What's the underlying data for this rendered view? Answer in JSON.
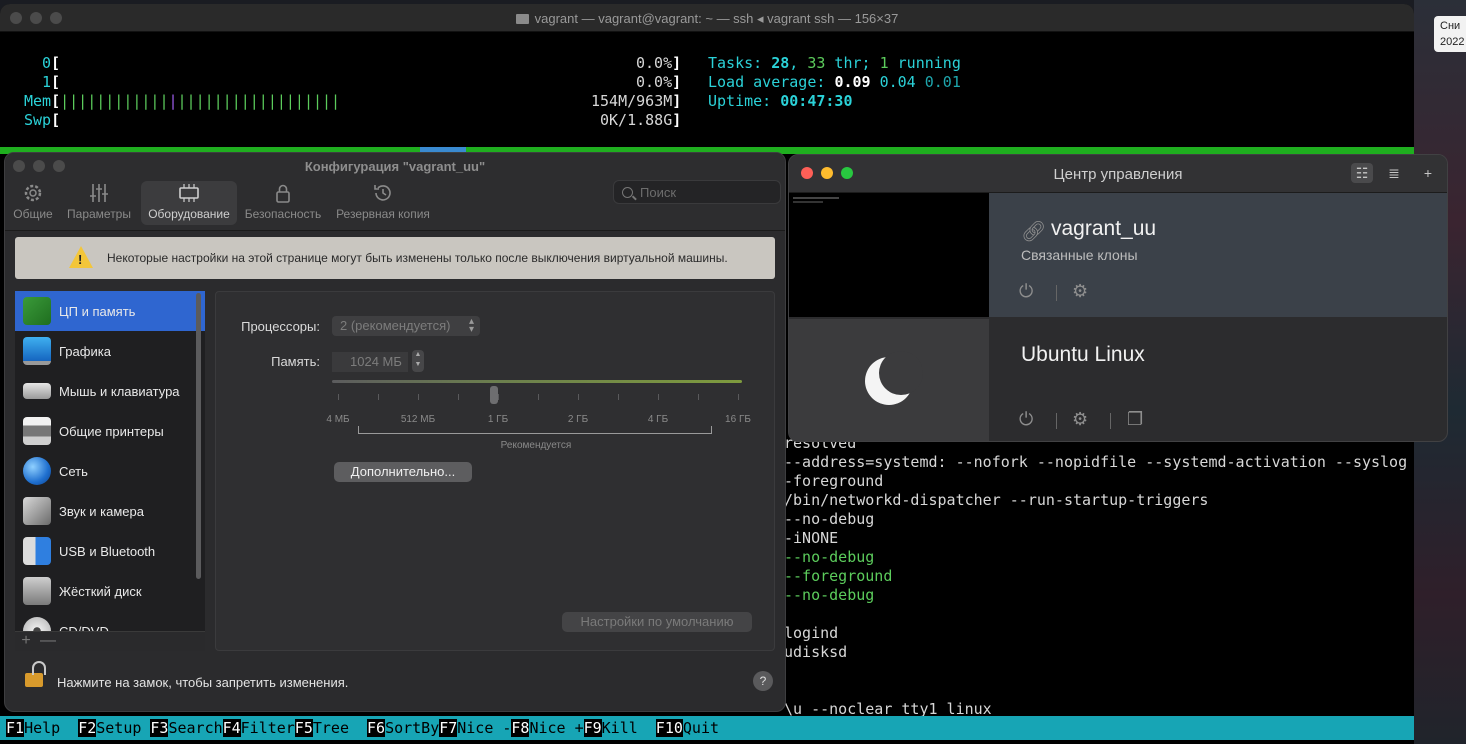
{
  "desktop": {
    "badge_line1": "Сни",
    "badge_line2": "2022"
  },
  "terminal": {
    "title": "vagrant — vagrant@vagrant: ~ — ssh ◂ vagrant ssh — 156×37",
    "cpu0": {
      "label": "0",
      "value": "0.0%"
    },
    "cpu1": {
      "label": "1",
      "value": "0.0%"
    },
    "mem": {
      "label": "Mem",
      "value": "154M/963M"
    },
    "swp": {
      "label": "Swp",
      "value": "0K/1.88G"
    },
    "tasks_label": "Tasks: ",
    "tasks_count": "28",
    "thr_count": "33",
    "thr_label": " thr; ",
    "running_count": "1",
    "running_label": " running",
    "load_label": "Load average: ",
    "load1": "0.09",
    "load5": "0.04",
    "load15": "0.01",
    "uptime_label": "Uptime: ",
    "uptime": "00:47:30",
    "lines": [
      {
        "text": "resolved",
        "color": "white"
      },
      {
        "text": "--address=systemd: --nofork --nopidfile --systemd-activation --syslog",
        "color": "white"
      },
      {
        "text": "-foreground",
        "color": "white"
      },
      {
        "text": "/bin/networkd-dispatcher --run-startup-triggers",
        "color": "white"
      },
      {
        "text": "--no-debug",
        "color": "white"
      },
      {
        "text": "-iNONE",
        "color": "white"
      },
      {
        "text": "--no-debug",
        "color": "green"
      },
      {
        "text": "--foreground",
        "color": "green"
      },
      {
        "text": "--no-debug",
        "color": "green"
      },
      {
        "text": "",
        "color": "white"
      },
      {
        "text": "logind",
        "color": "white"
      },
      {
        "text": "udisksd",
        "color": "white"
      },
      {
        "text": "",
        "color": "white"
      },
      {
        "text": "",
        "color": "white"
      },
      {
        "text": "\\u --noclear tty1 linux",
        "color": "white"
      }
    ],
    "fkeys": [
      {
        "key": "F1",
        "label": "Help  "
      },
      {
        "key": "F2",
        "label": "Setup "
      },
      {
        "key": "F3",
        "label": "Search"
      },
      {
        "key": "F4",
        "label": "Filter"
      },
      {
        "key": "F5",
        "label": "Tree  "
      },
      {
        "key": "F6",
        "label": "SortBy"
      },
      {
        "key": "F7",
        "label": "Nice -"
      },
      {
        "key": "F8",
        "label": "Nice +"
      },
      {
        "key": "F9",
        "label": "Kill  "
      },
      {
        "key": "F10",
        "label": "Quit"
      }
    ]
  },
  "config": {
    "title": "Конфигурация \"vagrant_uu\"",
    "tabs": [
      "Общие",
      "Параметры",
      "Оборудование",
      "Безопасность",
      "Резервная копия"
    ],
    "search_placeholder": "Поиск",
    "warning": "Некоторые настройки на этой странице могут быть изменены только после выключения виртуальной машины.",
    "sidebar": [
      "ЦП и память",
      "Графика",
      "Мышь и клавиатура",
      "Общие принтеры",
      "Сеть",
      "Звук и камера",
      "USB и Bluetooth",
      "Жёсткий диск",
      "CD/DVD"
    ],
    "processors_label": "Процессоры:",
    "processors_value": "2 (рекомендуется)",
    "memory_label": "Память:",
    "memory_value": "1024 МБ",
    "memory_level_fraction": 0.36,
    "scale": [
      "4 МБ",
      "512 МБ",
      "1 ГБ",
      "2 ГБ",
      "4 ГБ",
      "16 ГБ"
    ],
    "recommended": "Рекомендуется",
    "advanced_button": "Дополнительно...",
    "defaults_button": "Настройки по умолчанию",
    "lock_text": "Нажмите на замок, чтобы запретить изменения.",
    "help": "?",
    "add": "+",
    "remove": "—"
  },
  "control_center": {
    "title": "Центр управления",
    "vm1": {
      "name": "vagrant_uu",
      "subtitle": "Связанные клоны"
    },
    "vm2": {
      "name": "Ubuntu Linux"
    }
  },
  "colors": {
    "accent": "#2f66d0",
    "htop_cyan": "#2bd2d8",
    "htop_green": "#1fae1f",
    "fbar": "#17a5b5"
  }
}
